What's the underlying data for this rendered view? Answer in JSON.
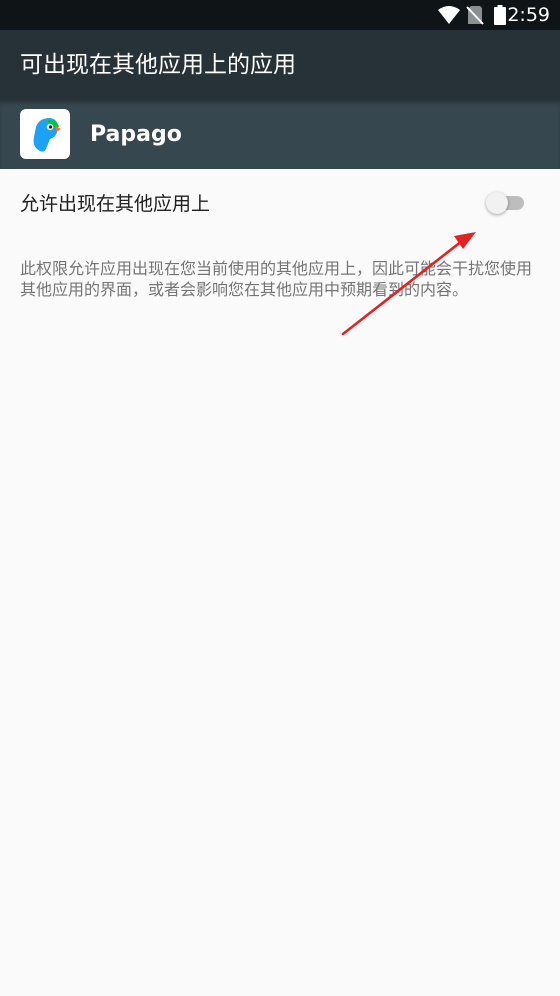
{
  "status_bar": {
    "time": "2:59",
    "icons": [
      "wifi-icon",
      "no-sim-icon",
      "battery-icon"
    ]
  },
  "app_bar": {
    "title": "可出现在其他应用上的应用"
  },
  "app_header": {
    "app_name": "Papago",
    "icon": "papago-parrot-icon"
  },
  "setting": {
    "label": "允许出现在其他应用上",
    "enabled": false
  },
  "description": "此权限允许应用出现在您当前使用的其他应用上，因此可能会干扰您使用其他应用的界面，或者会影响您在其他应用中预期看到的内容。",
  "colors": {
    "status_bar": "#0f1417",
    "app_bar": "#263238",
    "app_header": "#37474f",
    "background": "#fafafa",
    "annotation_arrow": "#e52222"
  }
}
